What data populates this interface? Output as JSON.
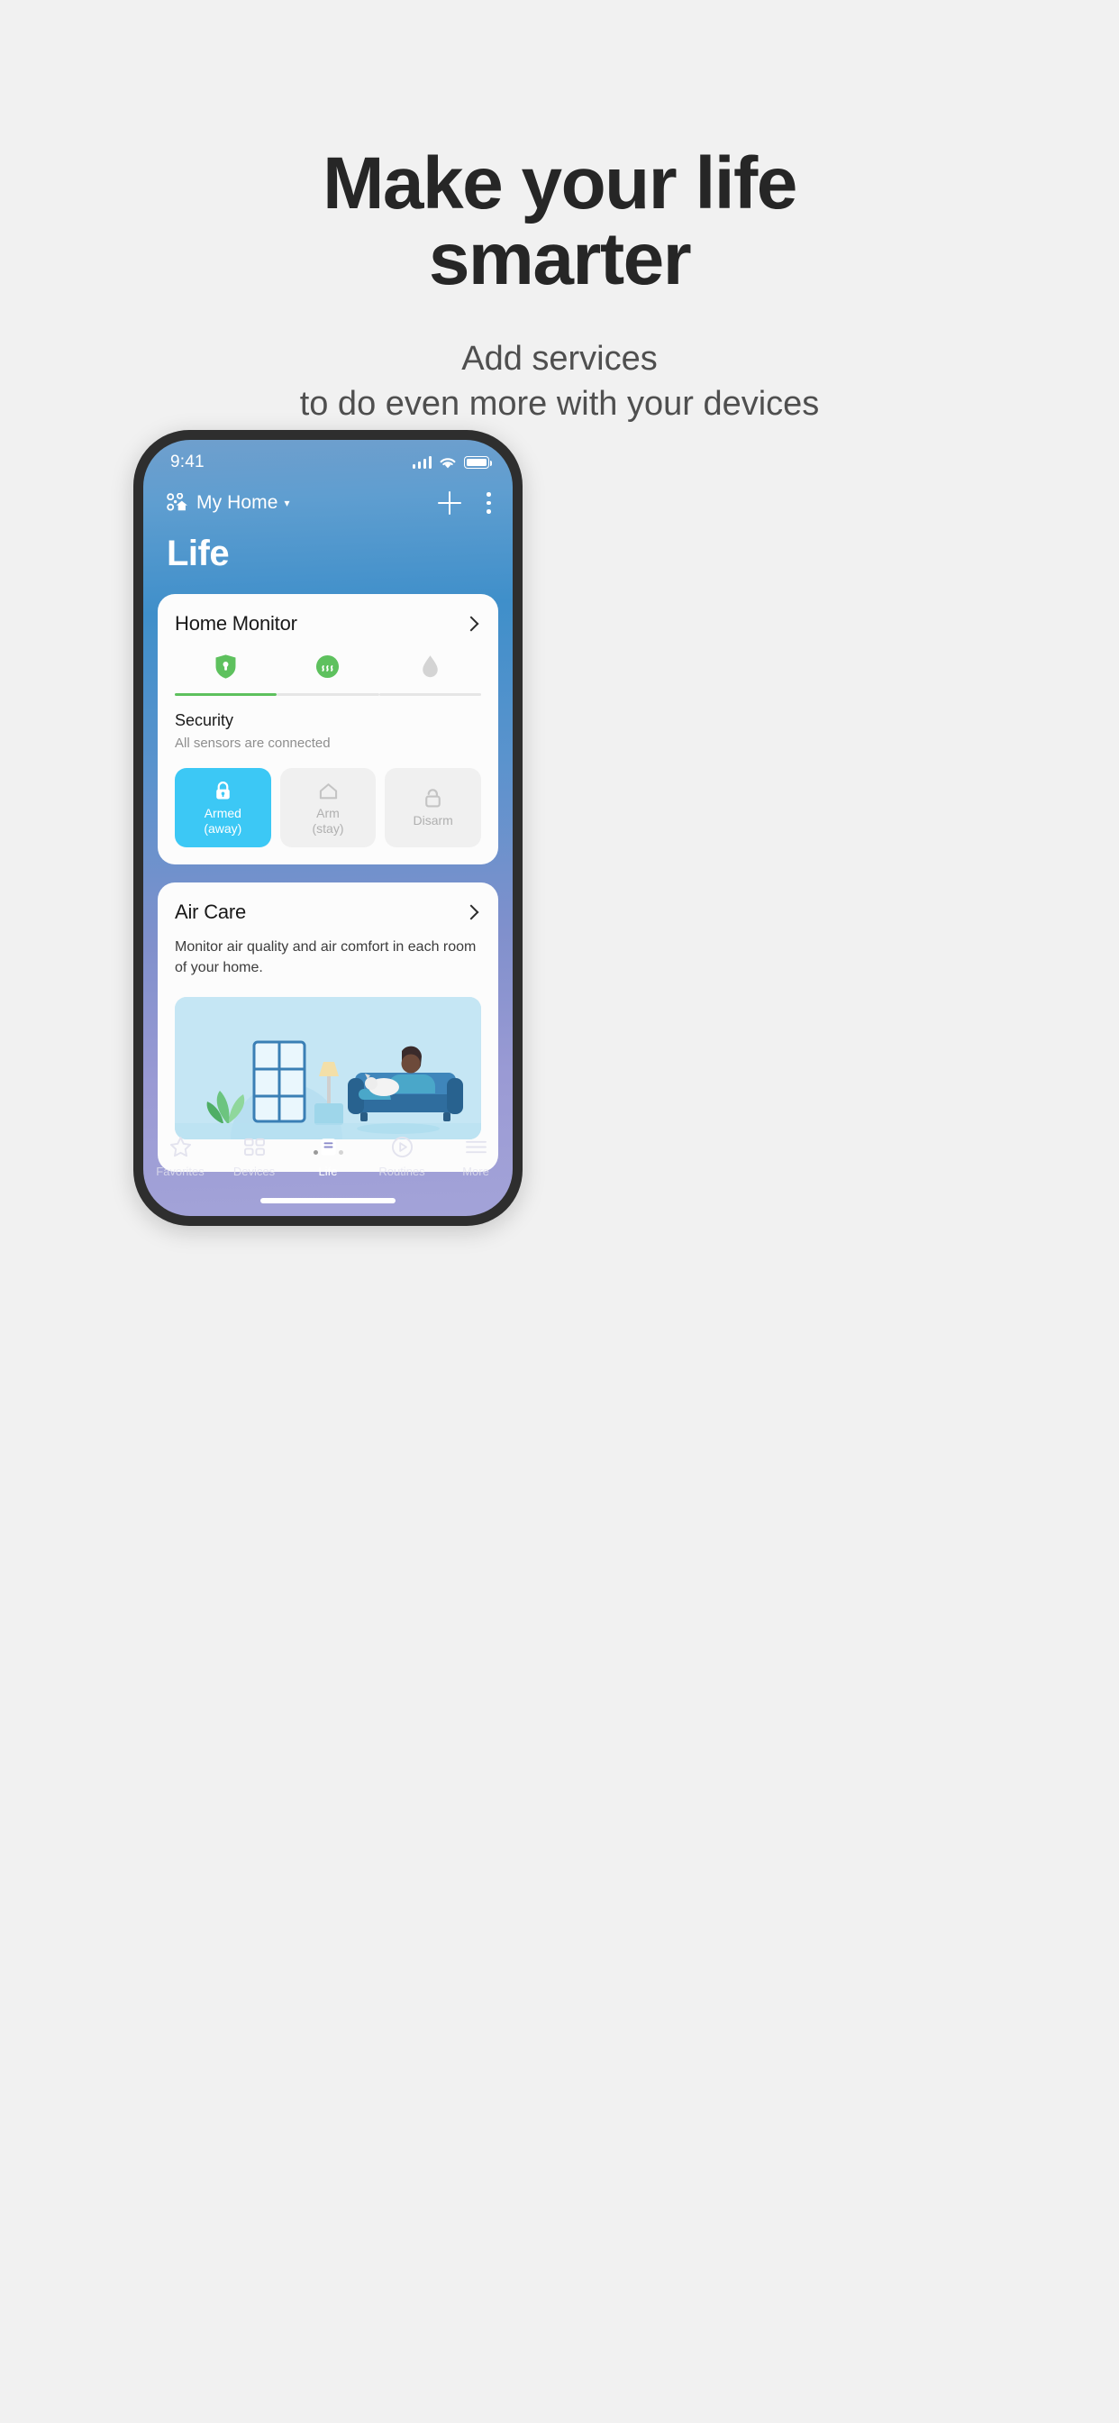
{
  "promo": {
    "title_line1": "Make your life",
    "title_line2": "smarter",
    "subtitle_line1": "Add services",
    "subtitle_line2": "to do even more with your devices"
  },
  "phone": {
    "statusbar": {
      "time": "9:41",
      "signal_icon": "signal-bars-icon",
      "wifi_icon": "wifi-icon",
      "battery_icon": "battery-full-icon"
    },
    "appbar": {
      "home_icon": "smartthings-home-icon",
      "home_name": "My Home",
      "caret": "▾",
      "add_icon": "plus-icon",
      "more_icon": "three-dot-menu-icon"
    },
    "page_title": "Life"
  },
  "home_monitor": {
    "title": "Home Monitor",
    "chevron_icon": "chevron-right-icon",
    "tabs": [
      {
        "id": "security",
        "icon": "green-shield-keyhole-icon",
        "active": true
      },
      {
        "id": "smoke",
        "icon": "green-smoke-detector-icon",
        "active": false
      },
      {
        "id": "leak",
        "icon": "gray-water-drop-icon",
        "active": false
      }
    ],
    "section_name": "Security",
    "section_desc": "All sensors are connected",
    "modes": [
      {
        "label_line1": "Armed",
        "label_line2": "(away)",
        "icon": "lock-closed-icon",
        "active": true
      },
      {
        "label_line1": "Arm",
        "label_line2": "(stay)",
        "icon": "home-outline-icon",
        "active": false
      },
      {
        "label_line1": "Disarm",
        "label_line2": "",
        "icon": "lock-open-icon",
        "active": false
      }
    ]
  },
  "air_care": {
    "title": "Air Care",
    "chevron_icon": "chevron-right-icon",
    "description": "Monitor air quality and air comfort in each room of your home.",
    "illustration": "living-room-illustration",
    "pagination": [
      true,
      false,
      false
    ]
  },
  "bottom_nav": [
    {
      "label": "Favorites",
      "icon": "star-icon",
      "active": false
    },
    {
      "label": "Devices",
      "icon": "grid-icon",
      "active": false
    },
    {
      "label": "Life",
      "icon": "life-document-icon",
      "active": true
    },
    {
      "label": "Routines",
      "icon": "play-circle-icon",
      "active": false
    },
    {
      "label": "More",
      "icon": "hamburger-icon",
      "active": false
    }
  ],
  "colors": {
    "accent_cyan": "#3cc8f5",
    "accent_green": "#5ec15e",
    "page_bg": "#f1f1f1",
    "illustration_bg": "#c5e6f4"
  }
}
